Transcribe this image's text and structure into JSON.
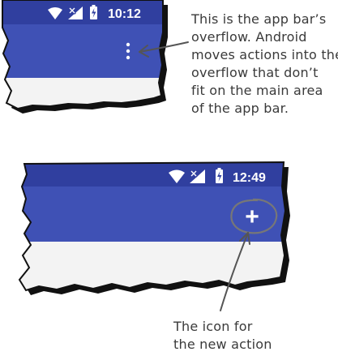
{
  "screens": [
    {
      "status_bar": {
        "time": "10:12",
        "icons": [
          "wifi-icon",
          "no-signal-icon",
          "battery-icon"
        ]
      },
      "app_bar": {
        "actions": [
          {
            "icon": "overflow-menu-icon"
          }
        ]
      }
    },
    {
      "status_bar": {
        "time": "12:49",
        "icons": [
          "wifi-icon",
          "no-signal-icon",
          "battery-icon"
        ]
      },
      "app_bar": {
        "actions": [
          {
            "icon": "add-icon",
            "glyph": "+"
          }
        ]
      }
    }
  ],
  "annotations": {
    "overflow": {
      "lines": [
        "This is the app bar’s",
        "overflow. Android",
        "moves actions into the",
        "overflow that don’t",
        "fit on the main area",
        "of the app bar."
      ]
    },
    "new_action": {
      "lines": [
        "The icon for",
        "the new action"
      ]
    }
  },
  "colors": {
    "app_bar": "#3f51b5",
    "status_bar": "#303f9f",
    "content": "#f3f3f3",
    "outline": "#111111",
    "annotation": "#3a3a3a"
  }
}
